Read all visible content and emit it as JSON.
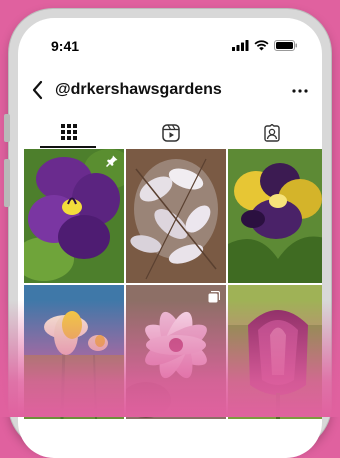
{
  "status": {
    "time": "9:41"
  },
  "header": {
    "username": "@drkershawsgardens"
  },
  "tabs": [
    {
      "icon": "grid-icon",
      "active": true
    },
    {
      "icon": "reels-icon",
      "active": false
    },
    {
      "icon": "tagged-icon",
      "active": false
    }
  ],
  "posts": [
    {
      "subject": "purple pansy",
      "badge": "pin-icon"
    },
    {
      "subject": "pale magnolia blossoms",
      "badge": ""
    },
    {
      "subject": "purple and yellow pansy",
      "badge": ""
    },
    {
      "subject": "yellow daffodil",
      "badge": ""
    },
    {
      "subject": "pink magnolia flower",
      "badge": "carousel-icon"
    },
    {
      "subject": "magenta tulip",
      "badge": ""
    }
  ],
  "colors": {
    "background": "#e0619f",
    "phone": "#d8d8d8",
    "screen": "#ffffff"
  }
}
